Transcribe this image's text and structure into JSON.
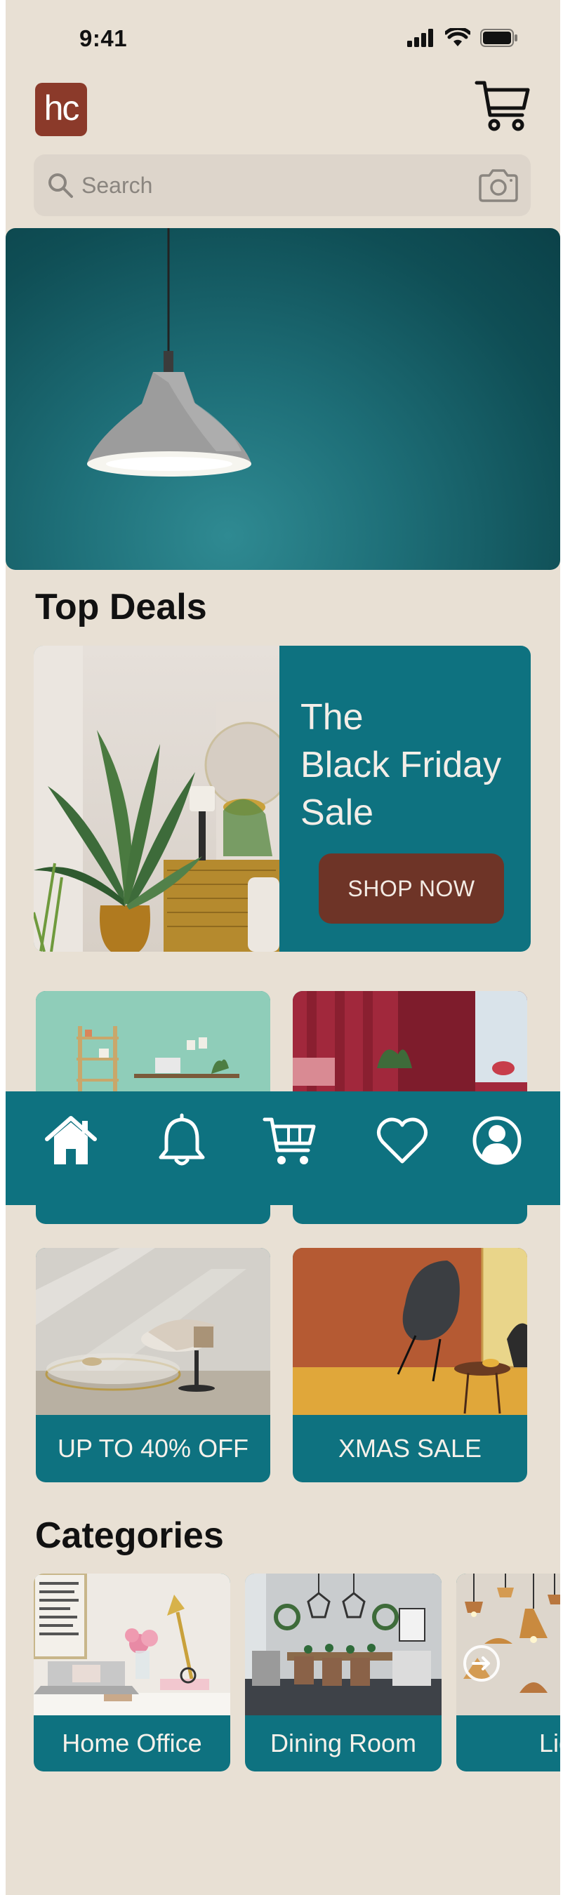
{
  "status_bar": {
    "time": "9:41"
  },
  "header": {
    "logo_text": "hc"
  },
  "search": {
    "placeholder": "Search"
  },
  "sections": {
    "top_deals": "Top Deals",
    "categories": "Categories"
  },
  "black_friday": {
    "line1": "The",
    "line2": "Black Friday",
    "line3": "Sale",
    "button": "SHOP NOW"
  },
  "promos": [
    {
      "label": ""
    },
    {
      "label": ""
    },
    {
      "label": "UP TO 40% OFF"
    },
    {
      "label": "XMAS SALE"
    }
  ],
  "nav": {
    "items": [
      "home-icon",
      "bell-icon",
      "cart-icon",
      "heart-icon",
      "profile-icon"
    ]
  },
  "categories": [
    {
      "label": "Home Office"
    },
    {
      "label": "Dining Room"
    },
    {
      "label": "Ligh"
    }
  ],
  "colors": {
    "teal": "#0e7280",
    "brand": "#8b3a2a",
    "button": "#6e3427",
    "background": "#e8e0d4"
  }
}
